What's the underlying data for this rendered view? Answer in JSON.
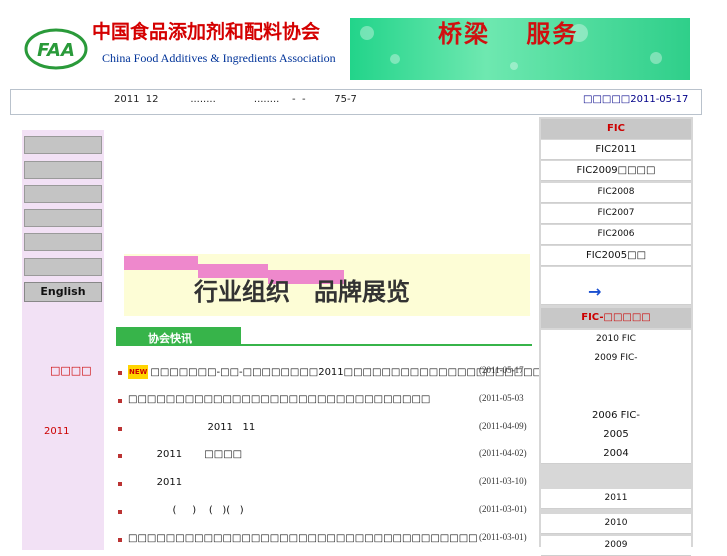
{
  "header": {
    "title_cn": "中国食品添加剂和配料协会",
    "title_en": "China Food Additives & Ingredients Association",
    "logo_text": "FAA",
    "banner_text": "桥梁　 服务"
  },
  "notice": {
    "text": "2011  12          ........            ........    -  -         75-7",
    "date": "□□□□□2011-05-17"
  },
  "left_nav": {
    "english_label": "English",
    "red_label": "□□□□",
    "year_label": "2011"
  },
  "center": {
    "banner_text": "行业组织　品牌展览",
    "section_title": "协会快讯",
    "new_tag": "NEW",
    "news": [
      {
        "text": "□□□□□□□-□□-□□□□□□□□2011□□□□□□□□□□□□□□□□□□□□□□□□□□□□□□",
        "date": "(2011-05-17",
        "new": true
      },
      {
        "text": "□□□□□□□□□□□□□□□□□□□□□□□□□□□□□□□□",
        "date": "(2011-05-03",
        "new": false
      },
      {
        "text": "                         2011   11",
        "date": "(2011-04-09)",
        "new": false
      },
      {
        "text": "         2011       □□□□",
        "date": "(2011-04-02)",
        "new": false
      },
      {
        "text": "         2011",
        "date": "(2011-03-10)",
        "new": false
      },
      {
        "text": "              (     )    (   )(   )",
        "date": "(2011-03-01)",
        "new": false
      },
      {
        "text": "□□□□□□□□□□□□□□□□□□□□□□□□□□□□□□□□□□□□□",
        "date": "(2011-03-01)",
        "new": false
      }
    ]
  },
  "right_nav": {
    "fic_head": "FIC",
    "fic_items": [
      "FIC2011",
      "FIC2009□□□□",
      "FIC2008",
      "FIC2007",
      "FIC2006",
      "FIC2005□□"
    ],
    "fic_sub_head": "FIC-□□□□□",
    "sub_items": [
      "2010 FIC",
      "2009 FIC-",
      "",
      "",
      "2006 FIC-",
      "2005",
      "2004"
    ],
    "year_items": [
      "2011",
      "2010",
      "2009"
    ]
  },
  "colors": {
    "brand_red": "#d40000",
    "banner_green": "#37b44a",
    "left_pink": "#f2e1f5"
  }
}
